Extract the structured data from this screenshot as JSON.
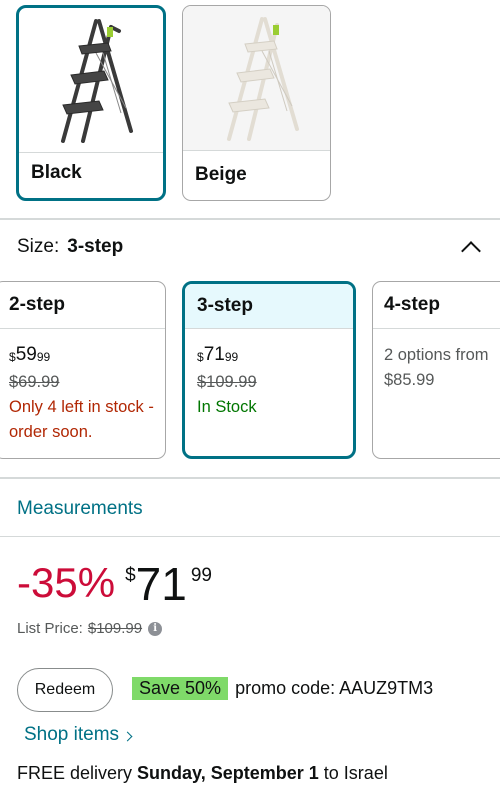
{
  "colors": {
    "accent": "#007185",
    "discount": "#cc0c39",
    "low_stock": "#b12704",
    "in_stock": "#007600",
    "promo_badge": "#7fda69"
  },
  "color_options": [
    {
      "label": "Black",
      "selected": true,
      "icon": "step-ladder-black-image"
    },
    {
      "label": "Beige",
      "selected": false,
      "icon": "step-ladder-beige-image"
    }
  ],
  "size": {
    "prefix": "Size:",
    "selected": "3-step",
    "options": [
      {
        "label": "2-step",
        "price_symbol": "$",
        "price_whole": "59",
        "price_fraction": "99",
        "list_price": "$69.99",
        "stock": "Only 4 left in stock - order soon."
      },
      {
        "label": "3-step",
        "price_symbol": "$",
        "price_whole": "71",
        "price_fraction": "99",
        "list_price": "$109.99",
        "stock": "In Stock"
      },
      {
        "label": "4-step",
        "options_text": "2 options from",
        "from_price": "$85.99"
      }
    ]
  },
  "measurements_link": "Measurements",
  "price": {
    "discount": "-35%",
    "symbol": "$",
    "whole": "71",
    "fraction": "99",
    "list_label": "List Price:",
    "list_value": "$109.99"
  },
  "promo": {
    "redeem_label": "Redeem",
    "badge": "Save 50%",
    "text": "promo code: AAUZ9TM3"
  },
  "shop_items_link": "Shop items",
  "delivery": {
    "prefix": "FREE delivery",
    "date": "Sunday, September 1",
    "suffix": "to Israel"
  }
}
